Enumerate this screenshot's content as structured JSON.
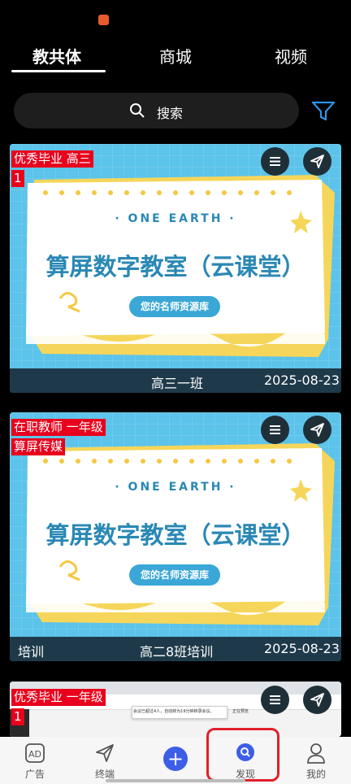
{
  "tabs": [
    "教共体",
    "商城",
    "视频"
  ],
  "search": {
    "label": "搜索"
  },
  "cards": [
    {
      "tags": [
        "优秀毕业 高三",
        "1"
      ],
      "banner": {
        "subtitle": "· ONE EARTH ·",
        "title": "算屏数字教室（云课堂）",
        "badge": "您的名师资源库"
      },
      "footer": {
        "left": "",
        "center": "高三一班",
        "date": "2025-08-23"
      }
    },
    {
      "tags": [
        "在职教师 一年级",
        "算屏传媒"
      ],
      "banner": {
        "subtitle": "· ONE EARTH ·",
        "title": "算屏数字教室（云课堂）",
        "badge": "您的名师资源库"
      },
      "footer": {
        "left": "培训",
        "center": "高二8班培训",
        "date": "2025-08-23"
      }
    },
    {
      "tags": [
        "优秀毕业 一年级",
        "1"
      ],
      "screenshot_text": [
        "会议已超过4人，自动转为19分钟转录会议。",
        "正在预览"
      ]
    }
  ],
  "bottom_nav": [
    {
      "label": "广告",
      "icon": "ad-icon"
    },
    {
      "label": "终端",
      "icon": "send-icon"
    },
    {
      "label": "",
      "icon": "plus-icon"
    },
    {
      "label": "发现",
      "icon": "discover-icon"
    },
    {
      "label": "我的",
      "icon": "profile-icon"
    }
  ],
  "colors": {
    "accent": "#3d5ee6",
    "tag": "#e8001c",
    "card_bg": "#5cc3ea",
    "title": "#2a88b5",
    "highlight": "#e0202a"
  }
}
